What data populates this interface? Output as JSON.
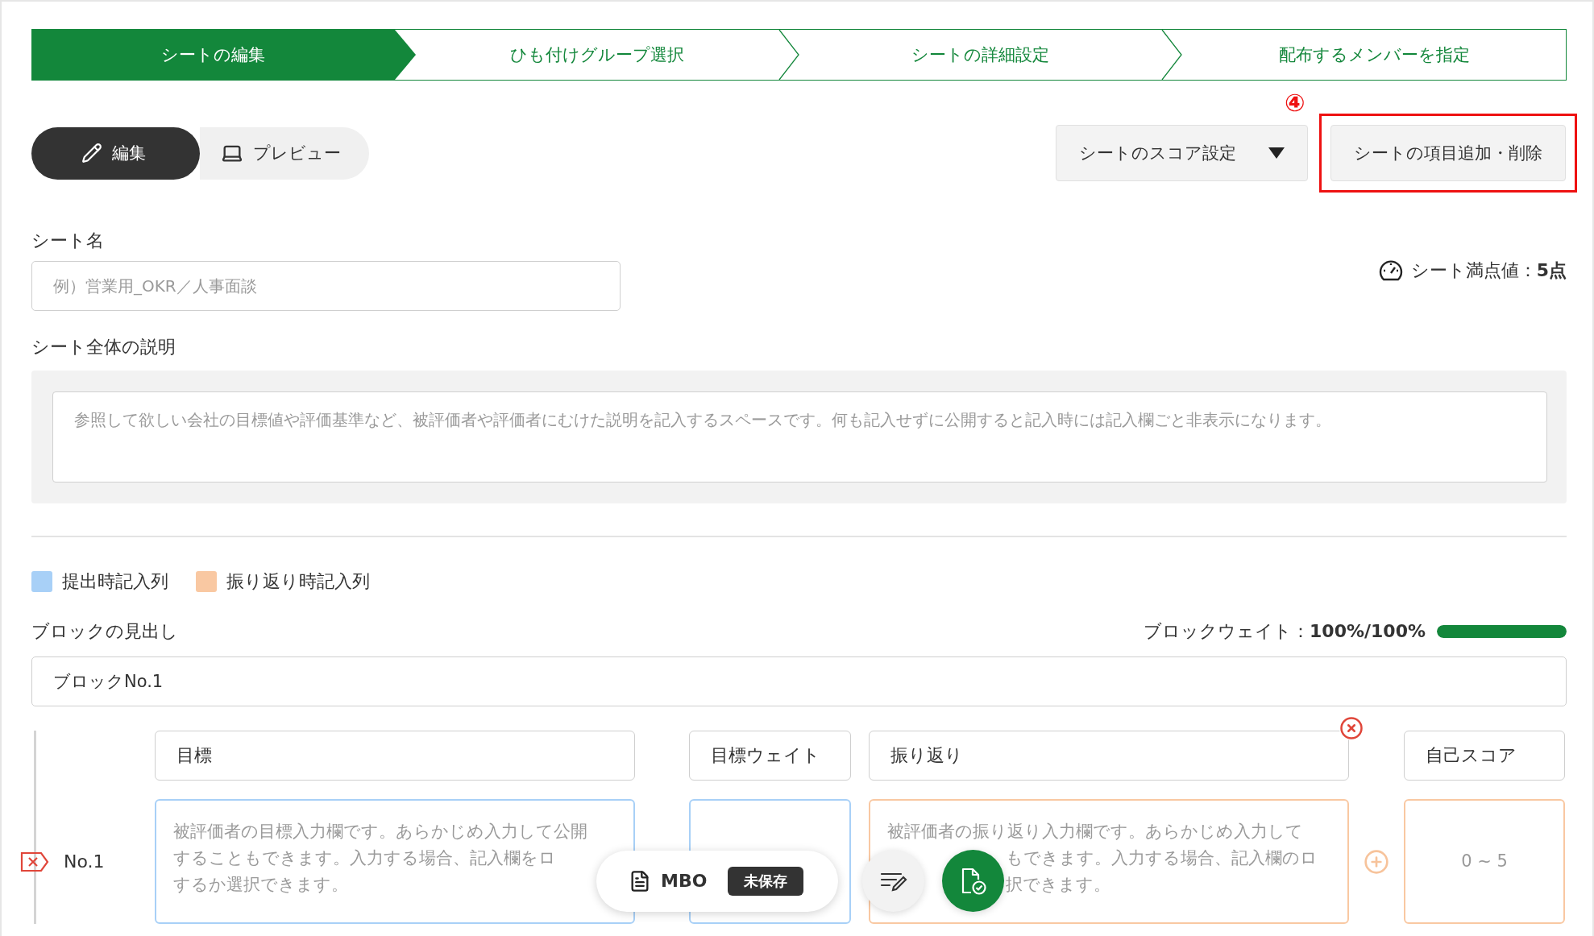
{
  "steps": [
    {
      "label": "シートの編集",
      "selected": true
    },
    {
      "label": "ひも付けグループ選択",
      "selected": false
    },
    {
      "label": "シートの詳細設定",
      "selected": false
    },
    {
      "label": "配布するメンバーを指定",
      "selected": false
    }
  ],
  "mode_toggle": [
    {
      "label": "編集",
      "kind": "edit",
      "selected": true
    },
    {
      "label": "プレビュー",
      "kind": "preview",
      "selected": false
    }
  ],
  "score_setting": {
    "label": "シートのスコア設定"
  },
  "add_remove_button": {
    "label": "シートの項目追加・削除",
    "highlighted": true,
    "callout": "④"
  },
  "sheet_name": {
    "label": "シート名",
    "placeholder": "例）営業用_OKR／人事面談"
  },
  "full_score": {
    "text": "シート満点値：**5点**"
  },
  "description": {
    "label": "シート全体の説明",
    "placeholder": "参照して欲しい会社の目標値や評価基準など、被評価者や評価者にむけた説明を記入するスペースです。何も記入せずに公開すると記入時には記入欄ごと非表示になります。"
  },
  "legend": [
    {
      "label": "提出時記入列",
      "color": "#a8d0f7"
    },
    {
      "label": "振り返り時記入列",
      "color": "#f9c8a2"
    }
  ],
  "block": {
    "label": "ブロックの見出し",
    "weight_text": "ブロックウェイト：**100%/100%**",
    "level": 1,
    "value": "ブロックNo.1"
  },
  "columns": [
    {
      "header": "目標",
      "kind": "submit",
      "placeholder": [
        "被評価者の目標入力欄です。あらかじめ入力して公開",
        "することもできます。入力する場合、記入欄をロ",
        "するか選択できます。"
      ],
      "removable": false
    },
    {
      "header": "目標ウェイト",
      "kind": "submit",
      "removable": false
    },
    {
      "header": "振り返り",
      "kind": "review",
      "placeholder": [
        "被評価者の振り返り入力欄です。あらかじめ入力して",
        "もできます。入力する場合、記入欄のロ",
        "択できます。"
      ],
      "removable": true
    },
    {
      "header": "自己スコア",
      "kind": "review",
      "placeholder": [
        "0 ~ 5"
      ],
      "removable": false
    }
  ],
  "rows": [
    {
      "label": "No.1"
    }
  ],
  "floating_bar": {
    "name": "MBO",
    "status": "未保存"
  }
}
